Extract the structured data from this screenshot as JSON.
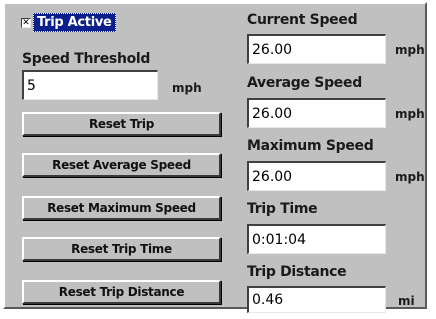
{
  "trip_active": {
    "label": "Trip Active",
    "checked": true,
    "check_glyph": "✕"
  },
  "speed_threshold": {
    "label": "Speed Threshold",
    "value": "5",
    "unit": "mph"
  },
  "buttons": {
    "reset_trip": "Reset Trip",
    "reset_average_speed": "Reset Average Speed",
    "reset_maximum_speed": "Reset Maximum Speed",
    "reset_trip_time": "Reset Trip Time",
    "reset_trip_distance": "Reset Trip Distance"
  },
  "current_speed": {
    "label": "Current Speed",
    "value": "26.00",
    "unit": "mph"
  },
  "average_speed": {
    "label": "Average Speed",
    "value": "26.00",
    "unit": "mph"
  },
  "maximum_speed": {
    "label": "Maximum Speed",
    "value": "26.00",
    "unit": "mph"
  },
  "trip_time": {
    "label": "Trip Time",
    "value": "0:01:04"
  },
  "trip_distance": {
    "label": "Trip Distance",
    "value": "0.46",
    "unit": "mi"
  },
  "colors": {
    "panel_bg": "#c0c0c0",
    "selection_bg": "#0a1e8c",
    "field_bg": "#ffffff"
  }
}
